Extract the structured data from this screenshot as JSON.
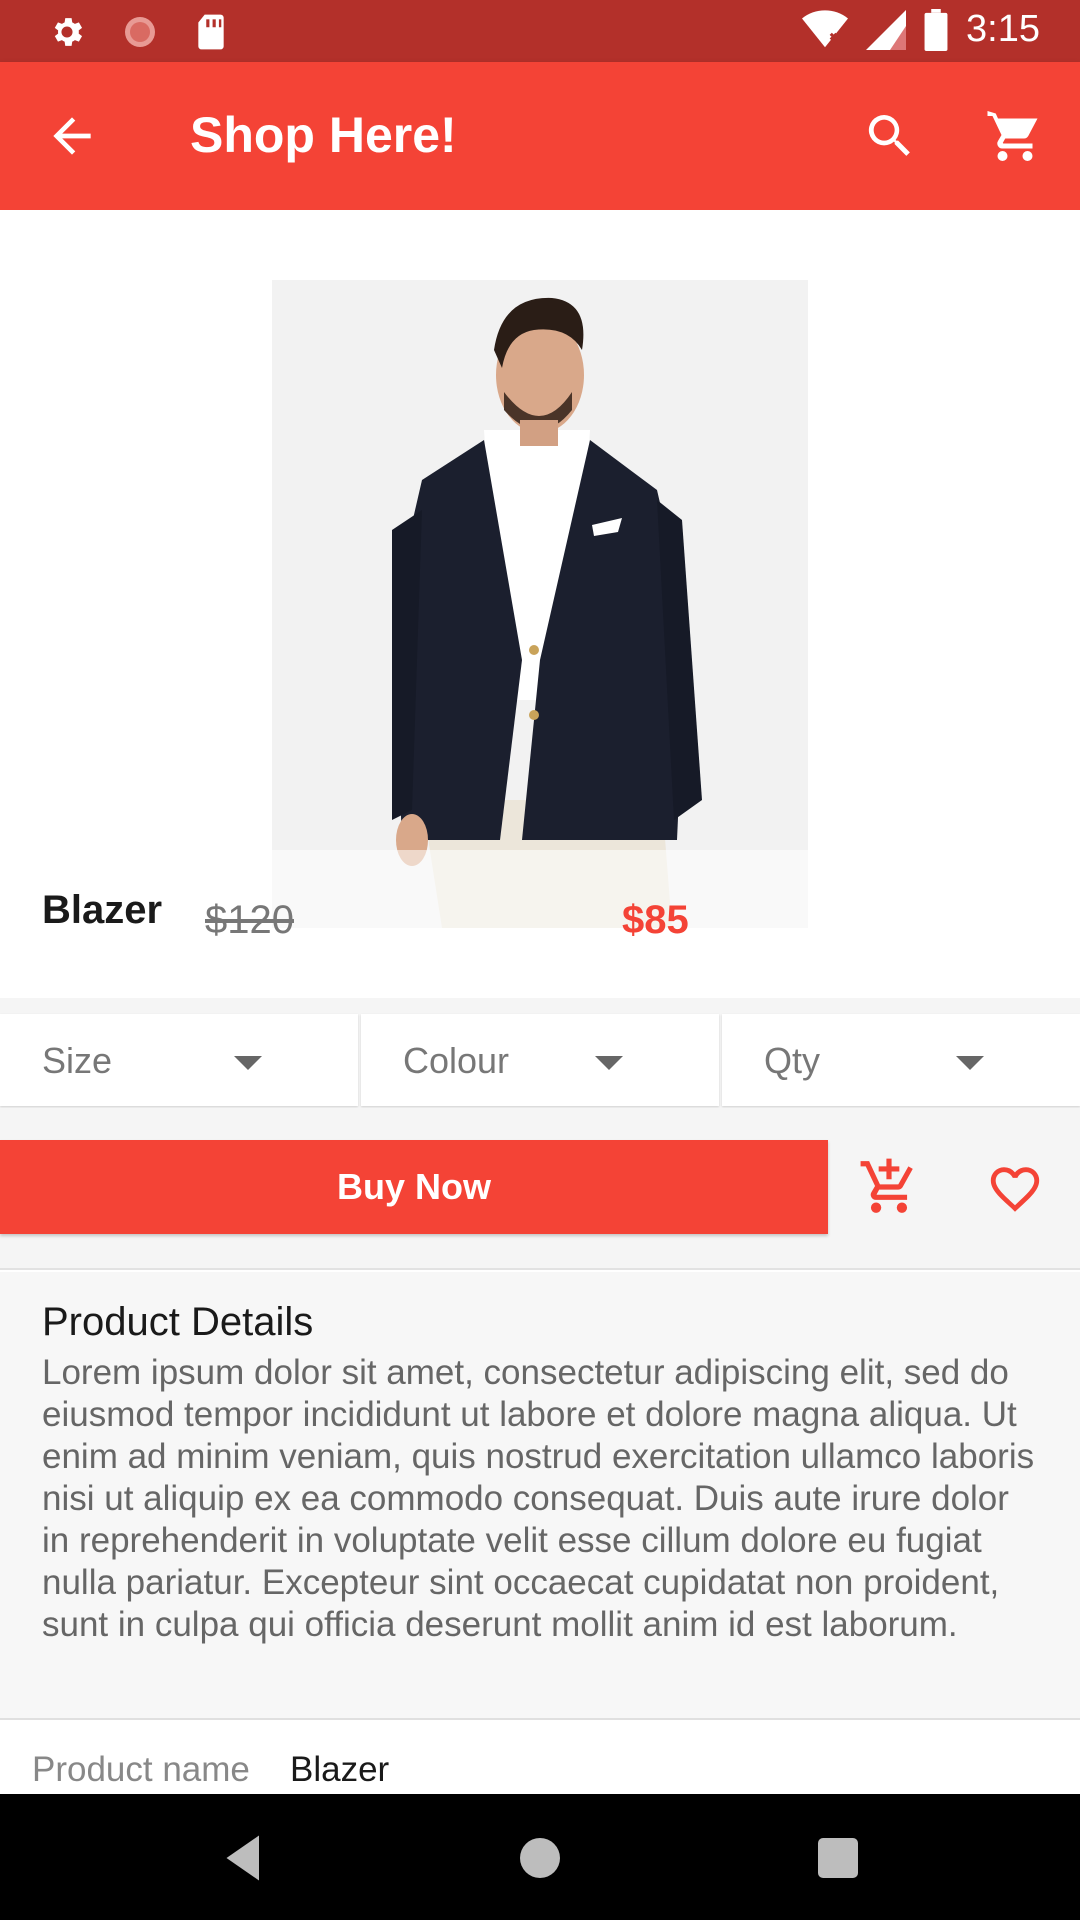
{
  "status_bar": {
    "time": "3:15",
    "icons": [
      "gear-icon",
      "sync-icon",
      "sd-card-icon",
      "wifi-icon",
      "signal-icon",
      "battery-icon"
    ]
  },
  "app_bar": {
    "title": "Shop Here!",
    "back_icon": "arrow-back-icon",
    "search_icon": "search-icon",
    "cart_icon": "shopping-cart-icon"
  },
  "product": {
    "name": "Blazer",
    "old_price": "$120",
    "new_price": "$85",
    "image_alt": "blazer-product-photo"
  },
  "selectors": [
    {
      "label": "Size"
    },
    {
      "label": "Colour"
    },
    {
      "label": "Qty"
    }
  ],
  "actions": {
    "buy_label": "Buy Now",
    "add_cart_icon": "add-shopping-cart-icon",
    "favorite_icon": "heart-outline-icon"
  },
  "details": {
    "heading": "Product Details",
    "body": "Lorem ipsum dolor sit amet, consectetur adipiscing elit, sed do eiusmod tempor incididunt ut labore et dolore magna aliqua. Ut enim ad minim veniam, quis nostrud exercitation ullamco laboris nisi ut aliquip ex ea commodo consequat. Duis aute irure dolor in reprehenderit in voluptate velit esse cillum dolore eu fugiat nulla pariatur. Excepteur sint occaecat cupidatat non proident, sunt in culpa qui officia deserunt mollit anim id est laborum."
  },
  "info": {
    "key": "Product name",
    "value": "Blazer"
  },
  "colors": {
    "primary": "#f44336",
    "status_bar": "#b3302a"
  }
}
